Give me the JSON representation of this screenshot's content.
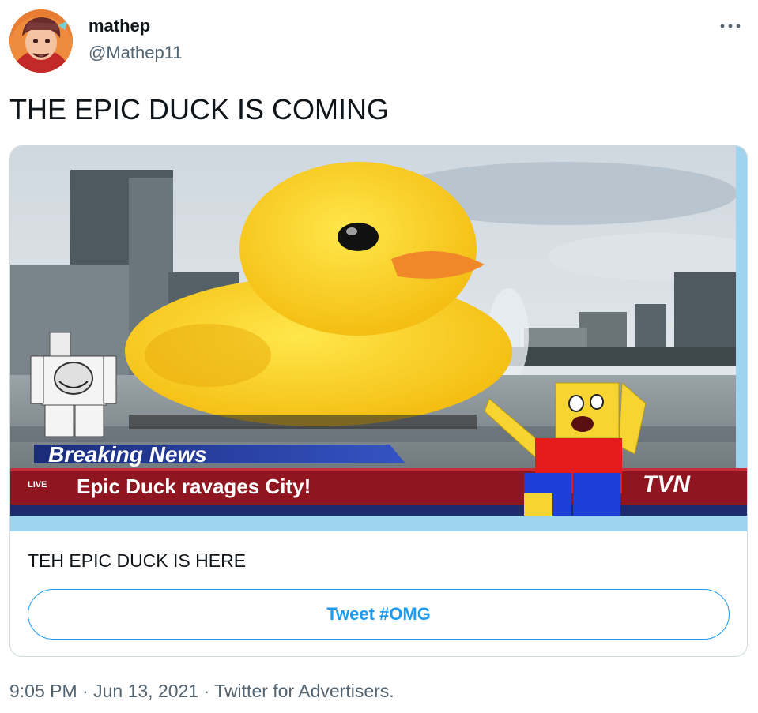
{
  "author": {
    "display_name": "mathep",
    "handle": "@Mathep11"
  },
  "tweet": {
    "text": "THE EPIC DUCK IS COMING"
  },
  "card": {
    "image": {
      "headline_banner": "Breaking News",
      "live_badge": "LIVE",
      "ticker": "Epic Duck ravages City!",
      "network_logo": "TVN"
    },
    "title": "TEH EPIC DUCK IS HERE",
    "cta_label": "Tweet #OMG"
  },
  "meta": {
    "time": "9:05 PM",
    "separator": "·",
    "date": "Jun 13, 2021",
    "source": "Twitter for Advertisers."
  },
  "colors": {
    "accent": "#1d9bf0",
    "secondary_text": "#536471",
    "border": "#cfd9de"
  },
  "icons": {
    "more": "more-horizontal-icon"
  }
}
